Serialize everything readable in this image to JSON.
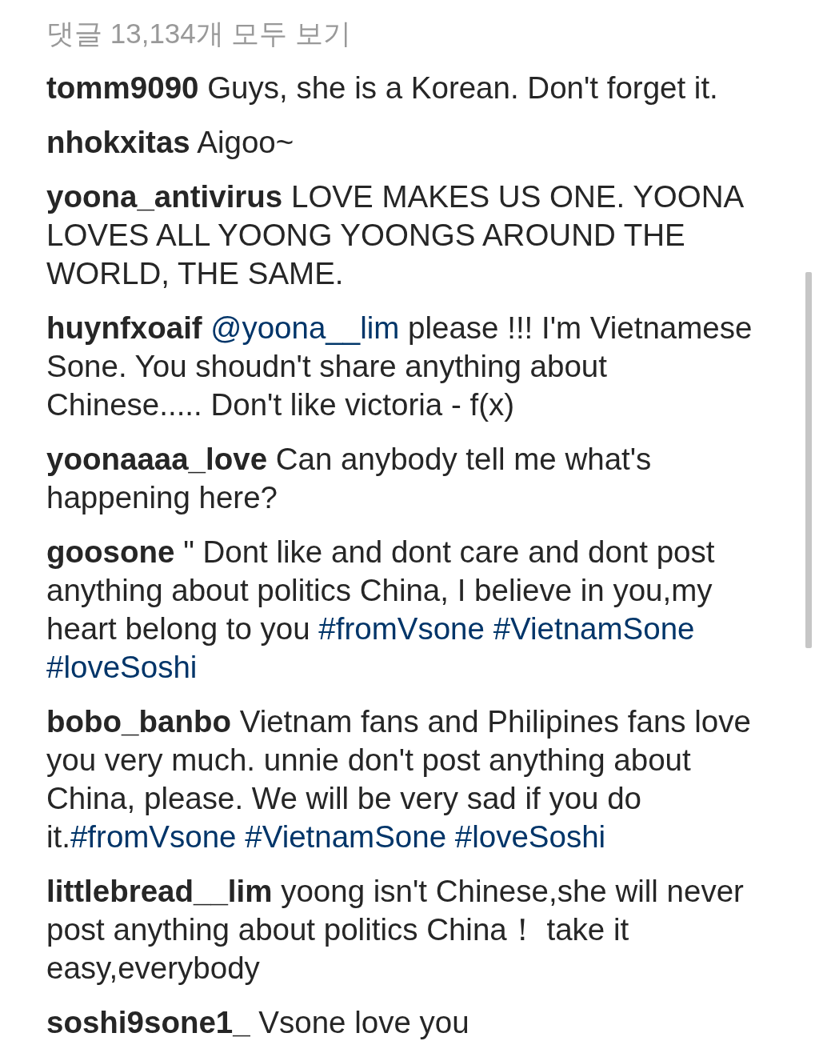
{
  "header": {
    "view_all_comments": "댓글 13,134개 모두 보기"
  },
  "comments": [
    {
      "username": "tomm9090",
      "segments": [
        {
          "kind": "text",
          "text": "Guys, she is a Korean. Don't forget it."
        }
      ]
    },
    {
      "username": "nhokxitas",
      "segments": [
        {
          "kind": "text",
          "text": "Aigoo~"
        }
      ]
    },
    {
      "username": "yoona_antivirus",
      "segments": [
        {
          "kind": "text",
          "text": "LOVE MAKES US ONE. YOONA LOVES ALL YOONG YOONGS AROUND THE WORLD, THE SAME."
        }
      ]
    },
    {
      "username": "huynfxoaif",
      "segments": [
        {
          "kind": "mention",
          "text": "@yoona__lim"
        },
        {
          "kind": "text",
          "text": " please !!! I'm Vietnamese Sone. You shoudn't share anything about Chinese..... Don't like victoria - f(x)"
        }
      ]
    },
    {
      "username": "yoonaaaa_love",
      "segments": [
        {
          "kind": "text",
          "text": "Can anybody tell me what's happening here?"
        }
      ]
    },
    {
      "username": "goosone",
      "segments": [
        {
          "kind": "text",
          "text": "\" Dont like and dont care and dont post anything about politics China, I believe in you,my heart belong to you "
        },
        {
          "kind": "hashtags",
          "tags": [
            "#fromVsone",
            "#VietnamSone",
            "#loveSoshi"
          ]
        }
      ]
    },
    {
      "username": "bobo_banbo",
      "segments": [
        {
          "kind": "text",
          "text": "Vietnam fans and Philipines fans love you very much. unnie don't post anything about China, please. We will be very sad if you do it."
        },
        {
          "kind": "hashtags",
          "tags": [
            "#fromVsone",
            "#VietnamSone",
            "#loveSoshi"
          ]
        }
      ]
    },
    {
      "username": "littlebread__lim",
      "segments": [
        {
          "kind": "text",
          "text": "yoong isn't Chinese,she will never post anything about politics China！ take it easy,everybody"
        }
      ]
    },
    {
      "username": "soshi9sone1_",
      "segments": [
        {
          "kind": "text",
          "text": "Vsone love you"
        }
      ]
    }
  ]
}
